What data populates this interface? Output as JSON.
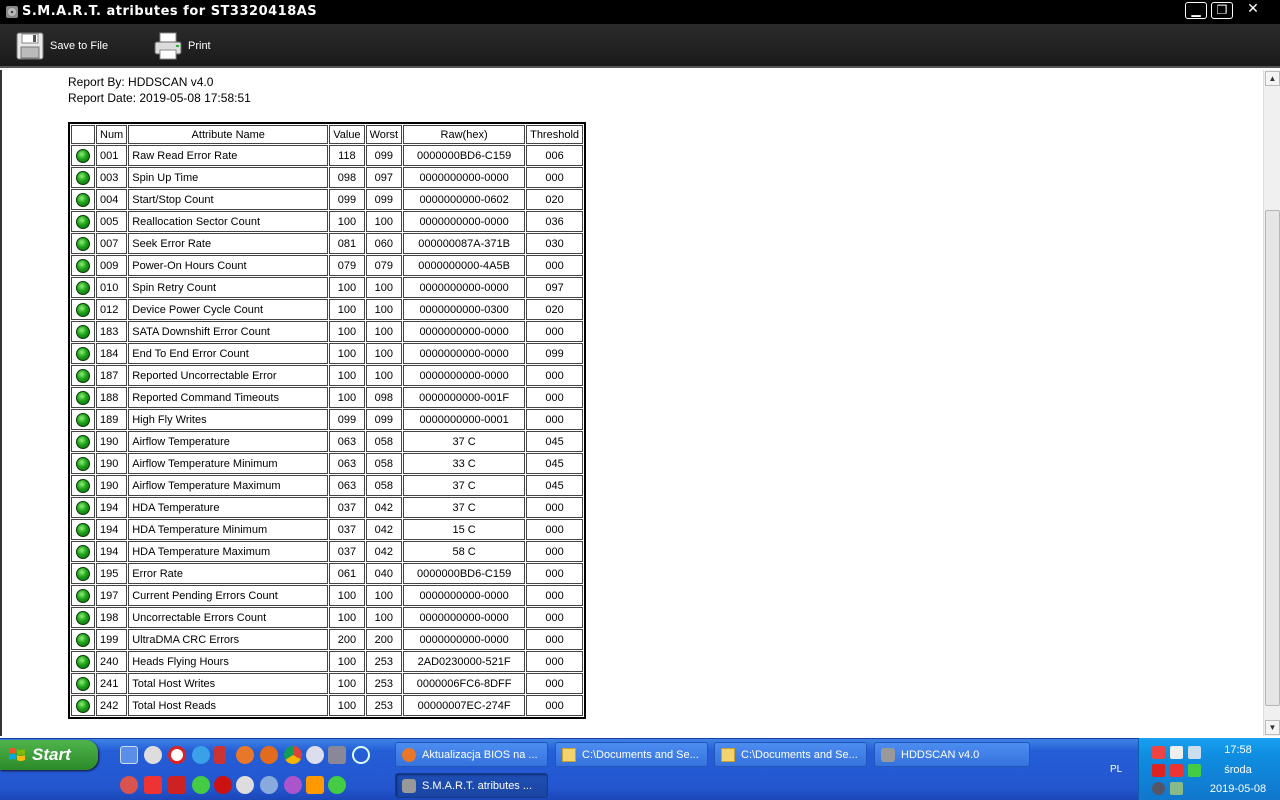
{
  "window": {
    "title": "S.M.A.R.T. atributes for ST3320418AS",
    "min_label": "▁",
    "max_label": "❐",
    "close_label": "✕"
  },
  "toolbar": {
    "save_label": "Save to File",
    "print_label": "Print"
  },
  "report": {
    "by": "Report By: HDDSCAN v4.0",
    "date": "Report Date: 2019-05-08 17:58:51"
  },
  "table": {
    "headers": [
      "",
      "Num",
      "Attribute Name",
      "Value",
      "Worst",
      "Raw(hex)",
      "Threshold"
    ],
    "status_color": "#1fa31a",
    "rows": [
      {
        "num": "001",
        "name": "Raw Read Error Rate",
        "value": "118",
        "worst": "099",
        "raw": "0000000BD6-C159",
        "threshold": "006"
      },
      {
        "num": "003",
        "name": "Spin Up Time",
        "value": "098",
        "worst": "097",
        "raw": "0000000000-0000",
        "threshold": "000"
      },
      {
        "num": "004",
        "name": "Start/Stop Count",
        "value": "099",
        "worst": "099",
        "raw": "0000000000-0602",
        "threshold": "020"
      },
      {
        "num": "005",
        "name": "Reallocation Sector Count",
        "value": "100",
        "worst": "100",
        "raw": "0000000000-0000",
        "threshold": "036"
      },
      {
        "num": "007",
        "name": "Seek Error Rate",
        "value": "081",
        "worst": "060",
        "raw": "000000087A-371B",
        "threshold": "030"
      },
      {
        "num": "009",
        "name": "Power-On Hours Count",
        "value": "079",
        "worst": "079",
        "raw": "0000000000-4A5B",
        "threshold": "000"
      },
      {
        "num": "010",
        "name": "Spin Retry Count",
        "value": "100",
        "worst": "100",
        "raw": "0000000000-0000",
        "threshold": "097"
      },
      {
        "num": "012",
        "name": "Device Power Cycle Count",
        "value": "100",
        "worst": "100",
        "raw": "0000000000-0300",
        "threshold": "020"
      },
      {
        "num": "183",
        "name": "SATA Downshift Error Count",
        "value": "100",
        "worst": "100",
        "raw": "0000000000-0000",
        "threshold": "000"
      },
      {
        "num": "184",
        "name": "End To End Error Count",
        "value": "100",
        "worst": "100",
        "raw": "0000000000-0000",
        "threshold": "099"
      },
      {
        "num": "187",
        "name": "Reported Uncorrectable Error",
        "value": "100",
        "worst": "100",
        "raw": "0000000000-0000",
        "threshold": "000"
      },
      {
        "num": "188",
        "name": "Reported Command Timeouts",
        "value": "100",
        "worst": "098",
        "raw": "0000000000-001F",
        "threshold": "000"
      },
      {
        "num": "189",
        "name": "High Fly Writes",
        "value": "099",
        "worst": "099",
        "raw": "0000000000-0001",
        "threshold": "000"
      },
      {
        "num": "190",
        "name": "Airflow Temperature",
        "value": "063",
        "worst": "058",
        "raw": "37 C",
        "threshold": "045"
      },
      {
        "num": "190",
        "name": "Airflow Temperature Minimum",
        "value": "063",
        "worst": "058",
        "raw": "33 C",
        "threshold": "045"
      },
      {
        "num": "190",
        "name": "Airflow Temperature Maximum",
        "value": "063",
        "worst": "058",
        "raw": "37 C",
        "threshold": "045"
      },
      {
        "num": "194",
        "name": "HDA Temperature",
        "value": "037",
        "worst": "042",
        "raw": "37 C",
        "threshold": "000"
      },
      {
        "num": "194",
        "name": "HDA Temperature Minimum",
        "value": "037",
        "worst": "042",
        "raw": "15 C",
        "threshold": "000"
      },
      {
        "num": "194",
        "name": "HDA Temperature Maximum",
        "value": "037",
        "worst": "042",
        "raw": "58 C",
        "threshold": "000"
      },
      {
        "num": "195",
        "name": "Error Rate",
        "value": "061",
        "worst": "040",
        "raw": "0000000BD6-C159",
        "threshold": "000"
      },
      {
        "num": "197",
        "name": "Current Pending Errors Count",
        "value": "100",
        "worst": "100",
        "raw": "0000000000-0000",
        "threshold": "000"
      },
      {
        "num": "198",
        "name": "Uncorrectable Errors Count",
        "value": "100",
        "worst": "100",
        "raw": "0000000000-0000",
        "threshold": "000"
      },
      {
        "num": "199",
        "name": "UltraDMA CRC Errors",
        "value": "200",
        "worst": "200",
        "raw": "0000000000-0000",
        "threshold": "000"
      },
      {
        "num": "240",
        "name": "Heads Flying Hours",
        "value": "100",
        "worst": "253",
        "raw": "2AD0230000-521F",
        "threshold": "000"
      },
      {
        "num": "241",
        "name": "Total Host Writes",
        "value": "100",
        "worst": "253",
        "raw": "0000006FC6-8DFF",
        "threshold": "000"
      },
      {
        "num": "242",
        "name": "Total Host Reads",
        "value": "100",
        "worst": "253",
        "raw": "00000007EC-274F",
        "threshold": "000"
      }
    ]
  },
  "taskbar": {
    "start_label": "Start",
    "tasks": [
      {
        "label": "Aktualizacja BIOS na ...",
        "icon": "firefox-icon"
      },
      {
        "label": "C:\\Documents and Se...",
        "icon": "folder-icon"
      },
      {
        "label": "C:\\Documents and Se...",
        "icon": "folder-icon"
      },
      {
        "label": "HDDSCAN v4.0",
        "icon": "hddscan-icon"
      },
      {
        "label": "S.M.A.R.T. atributes ...",
        "icon": "hddscan-icon"
      }
    ],
    "language": "PL",
    "clock": {
      "time": "17:58",
      "day": "środa",
      "date": "2019-05-08"
    }
  }
}
